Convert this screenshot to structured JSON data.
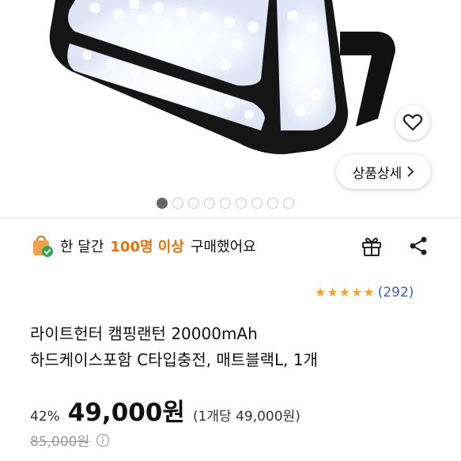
{
  "gallery": {
    "detail_label": "상품상세",
    "slide_count": 9,
    "active_slide": 1
  },
  "banner": {
    "prefix": "한 달간",
    "highlight": "100명 이상",
    "suffix": "구매했어요"
  },
  "rating": {
    "stars": 5,
    "review_count": "(292)"
  },
  "product": {
    "title_line1": "라이트헌터 캠핑랜턴 20000mAh",
    "title_line2": "하드케이스포함 C타입충전, 매트블랙L, 1개"
  },
  "price": {
    "discount": "42%",
    "sale_price": "49,000원",
    "unit_price": "(1개당 49,000원)",
    "original_price": "85,000원"
  },
  "colors": {
    "highlight": "#e8710a",
    "star": "#f2a23c",
    "review_link": "#3a63c8"
  }
}
